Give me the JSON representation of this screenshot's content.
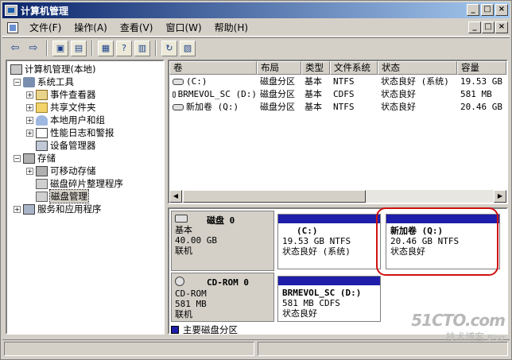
{
  "window": {
    "title": "计算机管理"
  },
  "menu": [
    "文件(F)",
    "操作(A)",
    "查看(V)",
    "窗口(W)",
    "帮助(H)"
  ],
  "title_controls": [
    "_",
    "□",
    "×"
  ],
  "doc_controls": [
    "_",
    "□",
    "×"
  ],
  "tree": [
    {
      "label": "计算机管理(本地)",
      "icon": "computer-icon"
    },
    {
      "label": "系统工具",
      "icon": "tools-icon"
    },
    {
      "label": "事件查看器",
      "icon": "event-log-icon"
    },
    {
      "label": "共享文件夹",
      "icon": "folder-icon"
    },
    {
      "label": "本地用户和组",
      "icon": "users-icon"
    },
    {
      "label": "性能日志和警报",
      "icon": "performance-icon"
    },
    {
      "label": "设备管理器",
      "icon": "device-manager-icon"
    },
    {
      "label": "存储",
      "icon": "storage-icon"
    },
    {
      "label": "可移动存储",
      "icon": "removable-storage-icon"
    },
    {
      "label": "磁盘碎片整理程序",
      "icon": "defrag-icon"
    },
    {
      "label": "磁盘管理",
      "icon": "disk-management-icon"
    },
    {
      "label": "服务和应用程序",
      "icon": "services-icon"
    }
  ],
  "volumes": {
    "columns": [
      "卷",
      "布局",
      "类型",
      "文件系统",
      "状态",
      "容量"
    ],
    "rows": [
      [
        "(C:)",
        "磁盘分区",
        "基本",
        "NTFS",
        "状态良好 (系统)",
        "19.53 GB"
      ],
      [
        "BRMEVOL_SC (D:)",
        "磁盘分区",
        "基本",
        "CDFS",
        "状态良好",
        "581 MB"
      ],
      [
        "新加卷 (Q:)",
        "磁盘分区",
        "基本",
        "NTFS",
        "状态良好",
        "20.46 GB"
      ]
    ]
  },
  "disks": [
    {
      "name": "磁盘 0",
      "type": "基本",
      "size": "40.00 GB",
      "status": "联机",
      "partitions": [
        {
          "name": "(C:)",
          "size_fs": "19.53 GB NTFS",
          "status": "状态良好 (系统)"
        },
        {
          "name": "新加卷 (Q:)",
          "size_fs": "20.46 GB NTFS",
          "status": "状态良好"
        }
      ]
    },
    {
      "name": "CD-ROM 0",
      "type": "CD-ROM",
      "size": "581 MB",
      "status": "联机",
      "partitions": [
        {
          "name": "BRMEVOL_SC (D:)",
          "size_fs": "581 MB CDFS",
          "status": "状态良好"
        }
      ]
    }
  ],
  "legend": {
    "label": "主要磁盘分区",
    "color": "#1e1eaa"
  },
  "watermark": {
    "brand": "51CTO.com",
    "sub": "技术博客",
    "tag": "Blog"
  },
  "colors": {
    "title_bar": "#0a246a",
    "partition_bar": "#1e1eaa",
    "highlight": "#d01010"
  }
}
